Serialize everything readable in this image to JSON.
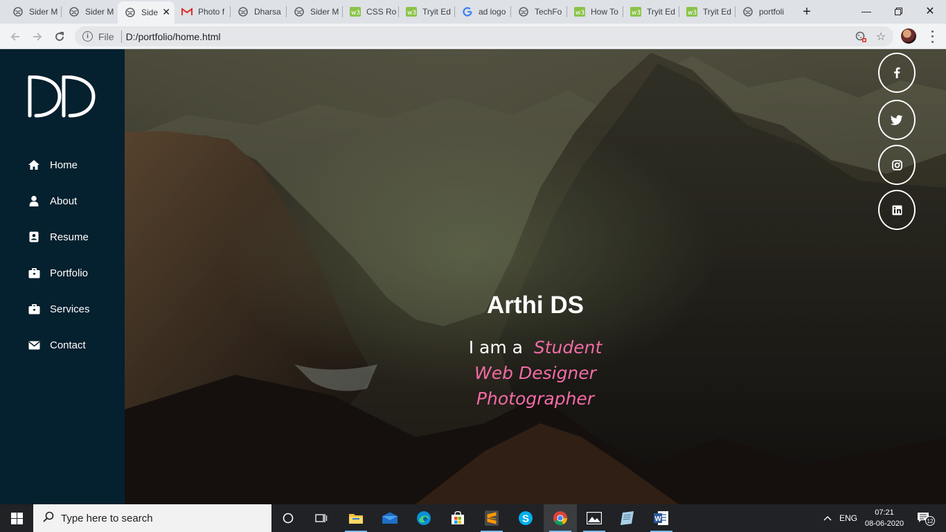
{
  "browser": {
    "tabs": [
      {
        "title": "Sider M",
        "icon": "globe-icon"
      },
      {
        "title": "Sider M",
        "icon": "globe-icon"
      },
      {
        "title": "Side",
        "icon": "globe-icon",
        "active": true
      },
      {
        "title": "Photo f",
        "icon": "gmail-icon"
      },
      {
        "title": "Dharsa",
        "icon": "globe-icon"
      },
      {
        "title": "Sider M",
        "icon": "globe-icon"
      },
      {
        "title": "CSS Ro",
        "icon": "w3schools-icon"
      },
      {
        "title": "Tryit Ed",
        "icon": "w3schools-icon"
      },
      {
        "title": "ad logo",
        "icon": "google-icon"
      },
      {
        "title": "TechFo",
        "icon": "globe-icon"
      },
      {
        "title": "How To",
        "icon": "w3schools-icon"
      },
      {
        "title": "Tryit Ed",
        "icon": "w3schools-icon"
      },
      {
        "title": "Tryit Ed",
        "icon": "w3schools-icon"
      },
      {
        "title": "portfoli",
        "icon": "globe-icon"
      }
    ],
    "address": {
      "scheme_label": "File",
      "url": "D:/portfolio/home.html"
    }
  },
  "site": {
    "logo_text": "DD",
    "nav": [
      {
        "label": "Home",
        "icon": "home-icon"
      },
      {
        "label": "About",
        "icon": "user-icon"
      },
      {
        "label": "Resume",
        "icon": "id-badge-icon"
      },
      {
        "label": "Portfolio",
        "icon": "briefcase-icon"
      },
      {
        "label": "Services",
        "icon": "briefcase-icon"
      },
      {
        "label": "Contact",
        "icon": "envelope-icon"
      }
    ],
    "hero": {
      "name": "Arthi DS",
      "intro": "I am a",
      "roles": [
        "Student",
        "Web Designer",
        "Photographer"
      ]
    },
    "social": [
      {
        "icon": "facebook-icon"
      },
      {
        "icon": "twitter-icon"
      },
      {
        "icon": "instagram-icon"
      },
      {
        "icon": "linkedin-icon"
      }
    ],
    "colors": {
      "sidebar": "#05202e",
      "role_accent": "#f36ba6"
    }
  },
  "taskbar": {
    "search_placeholder": "Type here to search",
    "language": "ENG",
    "time": "07:21",
    "date": "08-06-2020",
    "notification_count": "12"
  }
}
